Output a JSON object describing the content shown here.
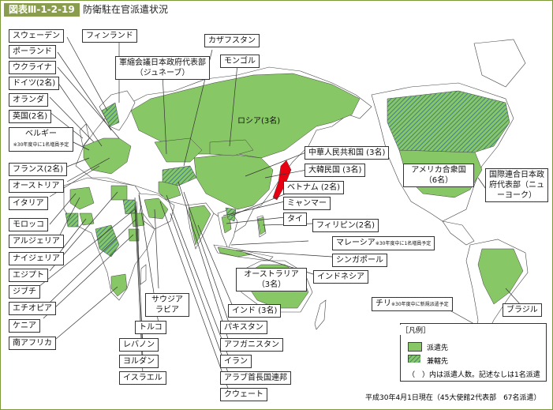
{
  "header": {
    "figure_no": "図表Ⅲ-1-2-19",
    "title": "防衛駐在官派遣状況"
  },
  "colors": {
    "dispatch": "#88c765",
    "concurrent": "#5c9e9a",
    "japan": "#e60012",
    "ocean": "#ffffff",
    "border": "#444444"
  },
  "labels": {
    "sweden": "スウェーデン",
    "finland": "フィンランド",
    "poland": "ポーランド",
    "ukraine": "ウクライナ",
    "germany": "ドイツ(2名)",
    "netherlands": "オランダ",
    "uk": "英国(2名)",
    "belgium": "ベルギー",
    "belgium_note": "※30年度中に1名増員予定",
    "france": "フランス(2名)",
    "austria": "オーストリア",
    "italy": "イタリア",
    "morocco": "モロッコ",
    "algeria": "アルジェリア",
    "nigeria": "ナイジェリア",
    "egypt": "エジプト",
    "djibouti": "ジブチ",
    "ethiopia": "エチオピア",
    "kenya": "ケニア",
    "south_africa": "南アフリカ",
    "geneva": "軍縮会議日本政府代表部（ジュネーブ）",
    "kazakhstan": "カザフスタン",
    "mongolia": "モンゴル",
    "russia": "ロシア(3名)",
    "china": "中華人民共和国 (3名)",
    "korea": "大韓民国 (3名)",
    "vietnam": "ベトナム (2名)",
    "myanmar": "ミャンマー",
    "thailand": "タイ",
    "philippines": "フィリピン(2名)",
    "malaysia": "マレーシア",
    "malaysia_note": "※30年度中に1名増員予定",
    "singapore": "シンガポール",
    "indonesia": "インドネシア",
    "australia": "オーストラリア（3名）",
    "usa": "アメリカ合衆国（6名）",
    "un": "国際連合日本政府代表部（ニューヨーク）",
    "chile": "チリ",
    "chile_note": "※30年度中に新規派遣予定",
    "brazil": "ブラジル",
    "saudi": "サウジアラビア",
    "turkey": "トルコ",
    "lebanon": "レバノン",
    "jordan": "ヨルダン",
    "israel": "イスラエル",
    "india": "インド (3名)",
    "pakistan": "パキスタン",
    "afghanistan": "アフガニスタン",
    "iran": "イラン",
    "uae": "アラブ首長国連邦",
    "kuwait": "クウェート"
  },
  "legend": {
    "title": "［凡例］",
    "dispatch": "派遣先",
    "concurrent": "兼轄先",
    "note": "（　）内は派遣人数。記述なしは1名派遣"
  },
  "footer": "平成30年4月1日現在（45大使館2代表部　67名派遣）"
}
